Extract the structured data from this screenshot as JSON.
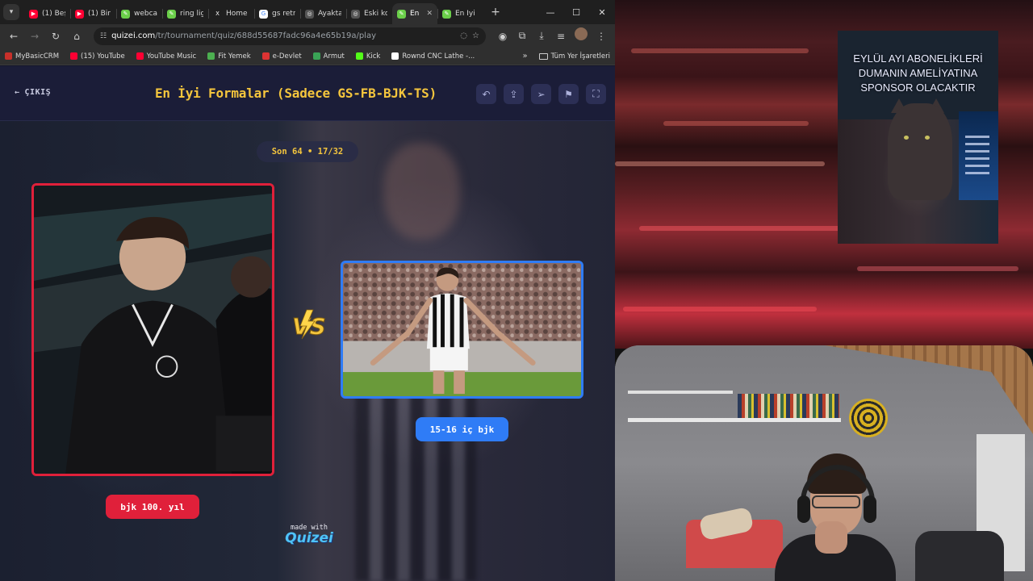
{
  "browser": {
    "tabs": [
      {
        "title": "(1) Beş",
        "fav_color": "#ff0033",
        "fav_glyph": "▶"
      },
      {
        "title": "(1) Bir",
        "fav_color": "#ff0033",
        "fav_glyph": "▶"
      },
      {
        "title": "webca",
        "fav_color": "#6bcf4a",
        "fav_glyph": "✎"
      },
      {
        "title": "ring lig",
        "fav_color": "#6bcf4a",
        "fav_glyph": "✎"
      },
      {
        "title": "Home",
        "fav_color": "#1f1f1f",
        "fav_glyph": "X"
      },
      {
        "title": "gs retr",
        "fav_color": "#ffffff",
        "fav_glyph": "G"
      },
      {
        "title": "Ayakta",
        "fav_color": "#555555",
        "fav_glyph": "◎"
      },
      {
        "title": "Eski ko",
        "fav_color": "#555555",
        "fav_glyph": "◎"
      },
      {
        "title": "En",
        "fav_color": "#6bcf4a",
        "fav_glyph": "✎",
        "active": true
      },
      {
        "title": "En İyi",
        "fav_color": "#6bcf4a",
        "fav_glyph": "✎"
      }
    ],
    "url_host": "quizei.com",
    "url_path": "/tr/tournament/quiz/688d55687fadc96a4e65b19a/play",
    "bookmarks": [
      {
        "label": "MyBasicCRM",
        "color": "#c8302a"
      },
      {
        "label": "(15) YouTube",
        "color": "#ff0033"
      },
      {
        "label": "YouTube Music",
        "color": "#ff0033"
      },
      {
        "label": "Fit Yemek",
        "color": "#4caf50"
      },
      {
        "label": "e-Devlet",
        "color": "#d33"
      },
      {
        "label": "Armut",
        "color": "#3aa356"
      },
      {
        "label": "Kick",
        "color": "#53fc18"
      },
      {
        "label": "Rownd CNC Lathe -...",
        "color": "#ffffff"
      }
    ],
    "bookmarks_folder": "Tüm Yer İşaretleri"
  },
  "quiz": {
    "exit_label": "ÇIKIŞ",
    "title": "En İyi Formalar (Sadece GS-FB-BJK-TS)",
    "round": "Son 64 • 17/32",
    "left_label": "bjk 100. yıl",
    "right_label": "15-16 iç bjk",
    "vs_text": "VS",
    "made_with": "made with",
    "brand": "Quizei",
    "colors": {
      "gold": "#f4c53d",
      "left": "#e0203a",
      "right": "#2f7cf6"
    }
  },
  "overlay": {
    "promo_lines": [
      "EYLÜL AYI ABONELİKLERİ",
      "DUMANIN AMELİYATINA",
      "SPONSOR OLACAKTIR"
    ]
  }
}
